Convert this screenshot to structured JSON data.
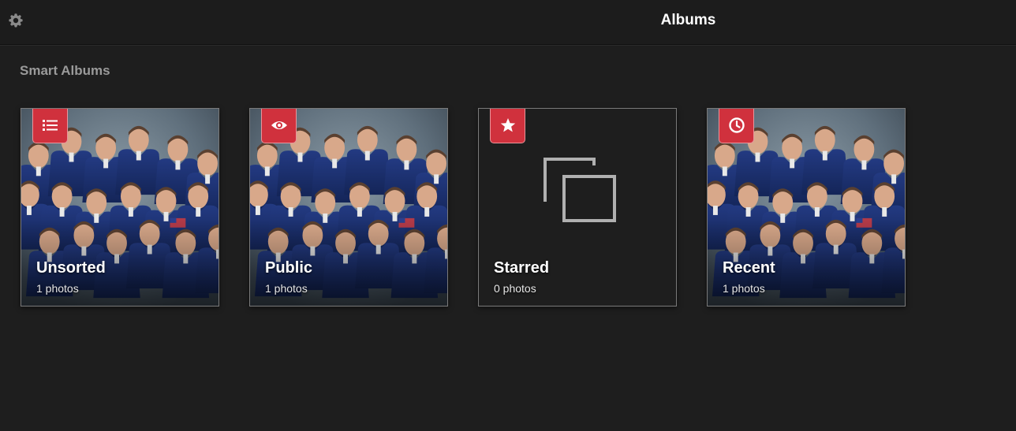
{
  "header": {
    "title": "Albums",
    "settings_icon": "gear-icon"
  },
  "smart_albums": {
    "section_title": "Smart Albums",
    "albums": [
      {
        "title": "Unsorted",
        "count": "1 photos",
        "icon": "list-icon",
        "has_thumb": true
      },
      {
        "title": "Public",
        "count": "1 photos",
        "icon": "eye-icon",
        "has_thumb": true
      },
      {
        "title": "Starred",
        "count": "0 photos",
        "icon": "star-icon",
        "has_thumb": false
      },
      {
        "title": "Recent",
        "count": "1 photos",
        "icon": "clock-icon",
        "has_thumb": true
      }
    ]
  },
  "colors": {
    "background": "#1e1e1e",
    "badge": "#d0313d",
    "section_title": "#9a9a9a"
  }
}
